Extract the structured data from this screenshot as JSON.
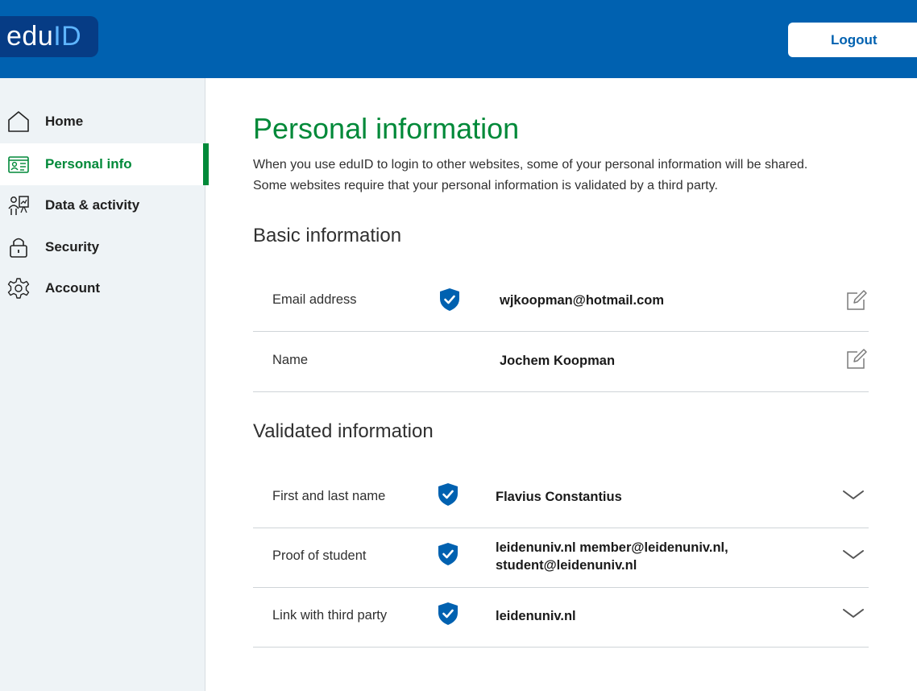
{
  "header": {
    "logo_part1": "edu",
    "logo_part2": "ID",
    "logout_label": "Logout"
  },
  "sidebar": {
    "items": [
      {
        "label": "Home",
        "icon": "home-icon"
      },
      {
        "label": "Personal info",
        "icon": "id-card-icon",
        "active": true
      },
      {
        "label": "Data & activity",
        "icon": "data-activity-icon"
      },
      {
        "label": "Security",
        "icon": "lock-icon"
      },
      {
        "label": "Account",
        "icon": "gear-icon"
      }
    ]
  },
  "main": {
    "title": "Personal information",
    "intro_line1": "When you use eduID to login to other websites, some of your personal information will be shared.",
    "intro_line2": "Some websites require that your personal information is validated by a third party.",
    "basic": {
      "title": "Basic information",
      "rows": [
        {
          "label": "Email address",
          "value": "wjkoopman@hotmail.com",
          "validated": true,
          "action": "edit-icon"
        },
        {
          "label": "Name",
          "value": "Jochem Koopman",
          "validated": false,
          "action": "edit-icon"
        }
      ]
    },
    "validated": {
      "title": "Validated information",
      "rows": [
        {
          "label": "First and last name",
          "value_line1": "Flavius Constantius",
          "value_line2": "",
          "validated": true,
          "action": "chevron-down-icon"
        },
        {
          "label": "Proof of student",
          "value_line1": "leidenuniv.nl member@leidenuniv.nl,",
          "value_line2": "student@leidenuniv.nl",
          "validated": true,
          "action": "chevron-down-icon"
        },
        {
          "label": "Link with third party",
          "value_line1": "leidenuniv.nl",
          "value_line2": "",
          "validated": true,
          "action": "chevron-down-icon"
        }
      ]
    }
  },
  "colors": {
    "header_blue": "#0061b0",
    "logo_dark": "#063c85",
    "accent_green": "#008939",
    "shield_blue": "#0061b0",
    "sidebar_bg": "#eef3f6"
  }
}
